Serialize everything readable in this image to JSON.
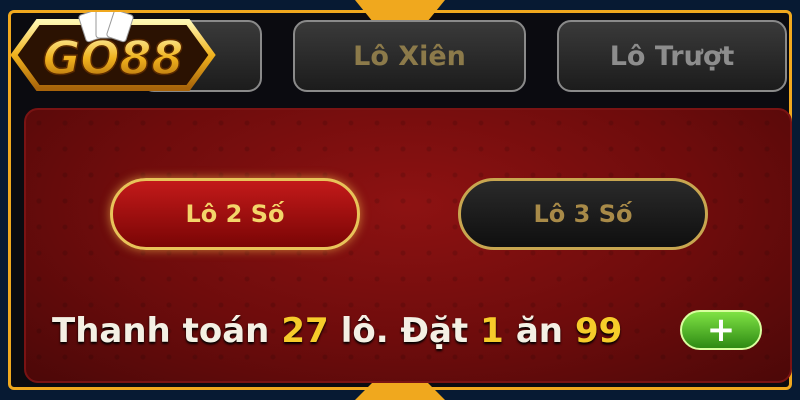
{
  "logo": {
    "text": "GO88"
  },
  "tabs": [
    {
      "label": ""
    },
    {
      "label": "Lô Xiên"
    },
    {
      "label": "Lô Trượt"
    }
  ],
  "options": {
    "active": "Lô 2 Số",
    "inactive": "Lô 3 Số"
  },
  "payout": {
    "prefix": "Thanh toán",
    "count": "27",
    "middle": "lô. Đặt",
    "bet": "1",
    "word_an": "ăn",
    "win": "99"
  },
  "icons": {
    "plus": "plus-icon"
  },
  "colors": {
    "accent": "#f0a81e",
    "panel": "#8d1212",
    "highlight": "#f6cc2a",
    "plus": "#5cc22e"
  }
}
